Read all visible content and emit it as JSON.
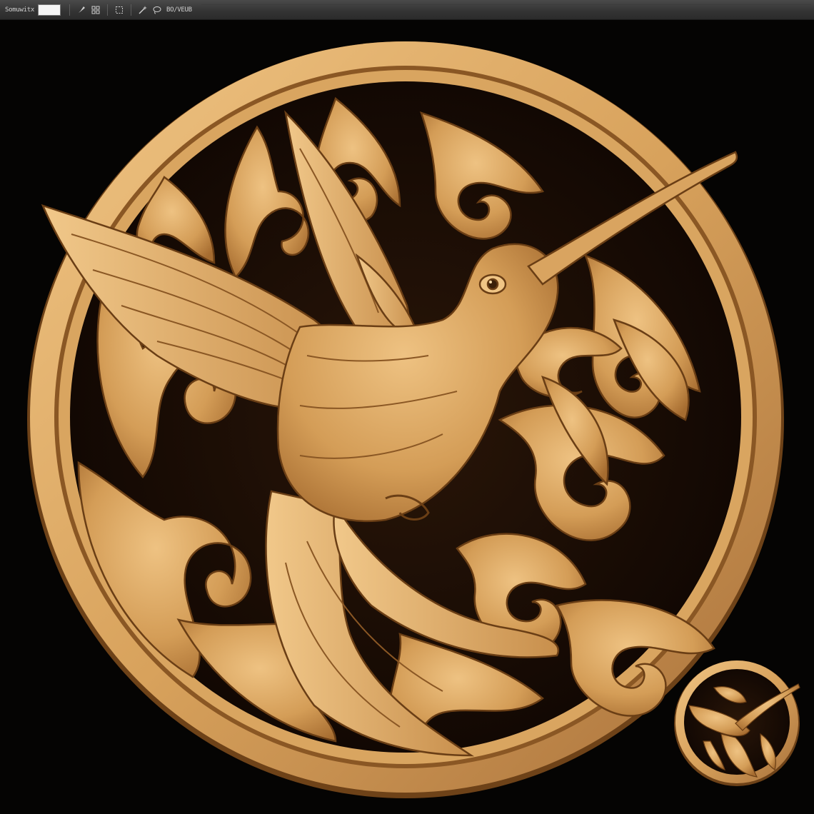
{
  "toolbar": {
    "left_label": "Somuwitx",
    "right_label": "BO/VEUB",
    "icons": [
      "brush-icon",
      "grid-icon",
      "selection-icon",
      "magic-wand-icon",
      "lasso-icon"
    ]
  },
  "colors": {
    "background": "#050403",
    "wood_light": "#e6b672",
    "wood_mid": "#c58c4a",
    "wood_dark": "#7a4a1c",
    "toolbar": "#3a3a3a"
  },
  "artwork": {
    "subject": "hummingbird-relief",
    "thumbnail": "hummingbird-thumbnail"
  }
}
